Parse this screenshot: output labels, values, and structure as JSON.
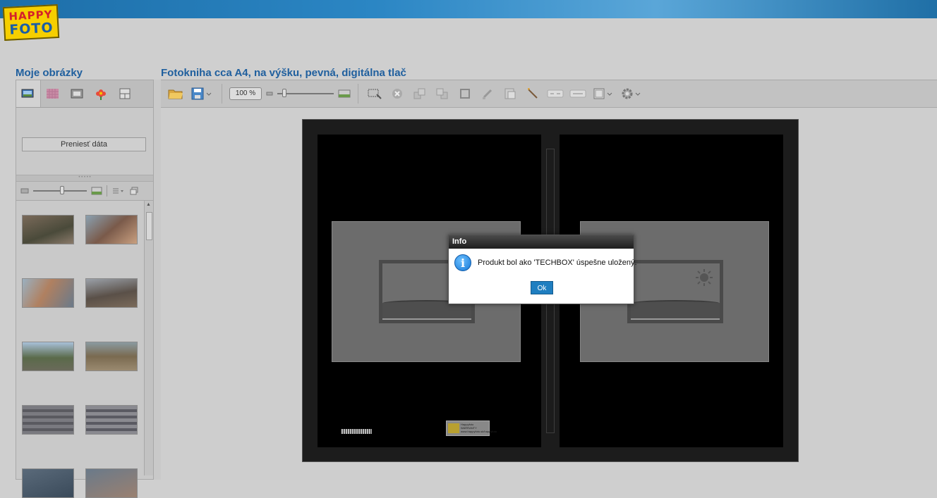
{
  "logo": {
    "line1": "HAPPY",
    "line2": "FOTO"
  },
  "left_panel": {
    "title": "Moje obrázky",
    "tabs": [
      "my-images-icon",
      "backgrounds-icon",
      "frames-icon",
      "cliparts-icon",
      "layouts-icon"
    ],
    "transfer_button": "Preniesť dáta"
  },
  "main": {
    "title": "Fotokniha cca A4, na výšku, pevná, digitálna tlač",
    "zoom": "100 %",
    "zoom_level_percent": 10
  },
  "sticker": {
    "text": "Happyfoto WARRANTY www.happyfoto.sk/happyfoto"
  },
  "dialog": {
    "title": "Info",
    "message": "Produkt bol ako 'TECHBOX' úspešne uložený.",
    "ok_label": "Ok"
  },
  "colors": {
    "accent": "#1f7ec0",
    "title_blue": "#1f5f9e",
    "topbar": "#2b86c4"
  }
}
